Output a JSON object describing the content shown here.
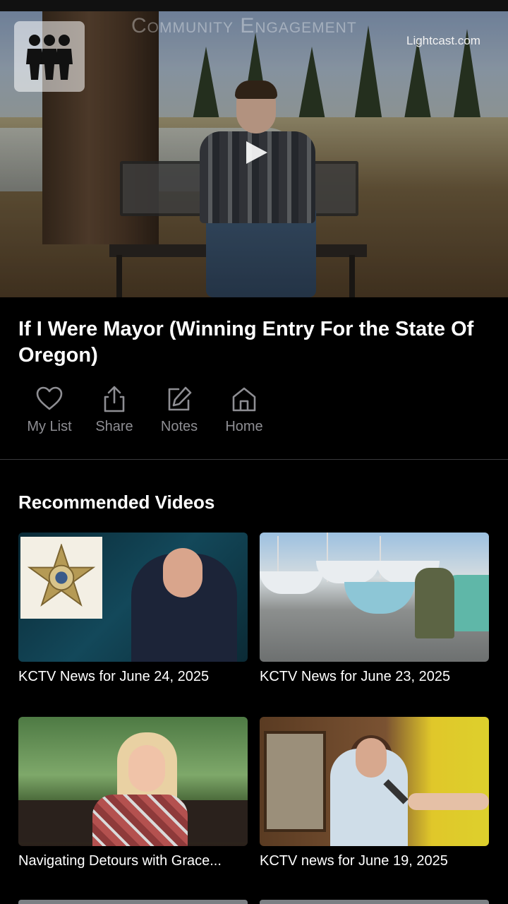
{
  "hero": {
    "overlay_title": "Community Engagement",
    "brand": "Lightcast.com",
    "logo_icon": "people-group-icon",
    "play_icon": "play-icon"
  },
  "video": {
    "title": "If I Were Mayor (Winning Entry For the State Of Oregon)"
  },
  "actions": [
    {
      "label": "My List",
      "icon": "heart-icon"
    },
    {
      "label": "Share",
      "icon": "share-icon"
    },
    {
      "label": "Notes",
      "icon": "edit-icon"
    },
    {
      "label": "Home",
      "icon": "home-icon"
    }
  ],
  "recommended": {
    "heading": "Recommended Videos",
    "items": [
      {
        "caption": "KCTV News for June 24, 2025"
      },
      {
        "caption": "KCTV News for June 23, 2025"
      },
      {
        "caption": "Navigating Detours with Grace..."
      },
      {
        "caption": "KCTV news for June 19, 2025"
      }
    ]
  },
  "colors": {
    "background": "#000000",
    "secondary_text": "#8e8e93",
    "divider": "#3a3a3c"
  }
}
